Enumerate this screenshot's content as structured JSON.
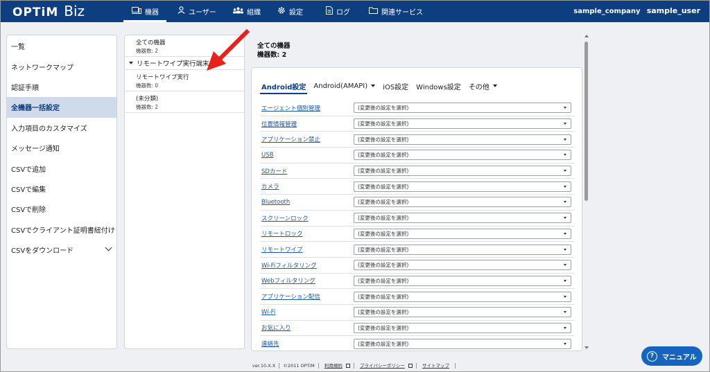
{
  "header": {
    "logo_brand": "OPTiM",
    "logo_product": "Biz",
    "nav": [
      {
        "label": "機器",
        "icon": "device-icon"
      },
      {
        "label": "ユーザー",
        "icon": "user-icon"
      },
      {
        "label": "組織",
        "icon": "organization-icon"
      },
      {
        "label": "設定",
        "icon": "gear-icon"
      },
      {
        "label": "ログ",
        "icon": "log-icon"
      },
      {
        "label": "関連サービス",
        "icon": "folder-icon"
      }
    ],
    "company": "sample_company",
    "user": "sample_user"
  },
  "sidebar": {
    "items": [
      {
        "label": "一覧"
      },
      {
        "label": "ネットワークマップ"
      },
      {
        "label": "認証手順"
      },
      {
        "label": "全機器一括設定"
      },
      {
        "label": "入力項目のカスタマイズ"
      },
      {
        "label": "メッセージ通知"
      },
      {
        "label": "CSVで追加"
      },
      {
        "label": "CSVで編集"
      },
      {
        "label": "CSVで削除"
      },
      {
        "label": "CSVでクライアント証明書紐付け"
      },
      {
        "label": "CSVをダウンロード"
      }
    ]
  },
  "groups": {
    "all": {
      "name": "全ての機器",
      "count": "機器数: 2"
    },
    "section": "リモートワイプ実行端末",
    "items": [
      {
        "name": "リモートワイプ実行",
        "count": "機器数: 0"
      },
      {
        "name": "(未分類)",
        "count": "機器数: 2"
      }
    ]
  },
  "main": {
    "title": "全ての機器",
    "count": "機器数: 2",
    "tabs": [
      {
        "label": "Android設定"
      },
      {
        "label": "Android(AMAPI)"
      },
      {
        "label": "iOS設定"
      },
      {
        "label": "Windows設定"
      },
      {
        "label": "その他"
      }
    ],
    "select_placeholder": "(変更後の設定を選択)",
    "rows": [
      {
        "label": "エージェント個別管理"
      },
      {
        "label": "位置情報管理"
      },
      {
        "label": "アプリケーション禁止"
      },
      {
        "label": "USB"
      },
      {
        "label": "SDカード"
      },
      {
        "label": "カメラ"
      },
      {
        "label": "Bluetooth"
      },
      {
        "label": "スクリーンロック"
      },
      {
        "label": "リモートロック"
      },
      {
        "label": "リモートワイプ"
      },
      {
        "label": "Wi-Fiフィルタリング"
      },
      {
        "label": "Webフィルタリング"
      },
      {
        "label": "アプリケーション配信"
      },
      {
        "label": "Wi-Fi"
      },
      {
        "label": "お気に入り"
      },
      {
        "label": "連絡先"
      }
    ]
  },
  "footer": {
    "version": "ver.10.X.X",
    "copyright": "©2011 OPTiM",
    "terms": "利用規約",
    "privacy": "プライバシーポリシー",
    "sitemap": "サイトマップ"
  },
  "manual_button": "マニュアル",
  "colors": {
    "header_bg": "#0d3e80",
    "accent": "#1565c0",
    "arrow": "#e8211b",
    "active_bg": "#cfdbea"
  }
}
